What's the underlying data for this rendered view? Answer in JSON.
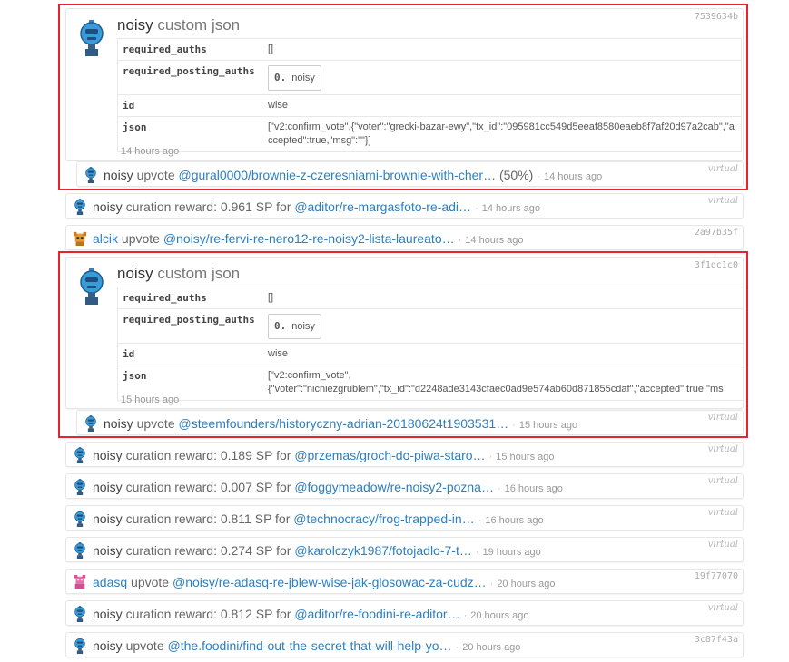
{
  "custom1": {
    "user": "noisy",
    "type": "custom json",
    "tag": "7539634b",
    "required_auths_label": "required_auths",
    "required_auths": "[]",
    "required_posting_auths_label": "required_posting_auths",
    "posting_index": "0.",
    "posting_name": "noisy",
    "id_label": "id",
    "id": "wise",
    "json_label": "json",
    "json": "[\"v2:confirm_vote\",{\"voter\":\"grecki-bazar-ewy\",\"tx_id\":\"095981cc549d5eeaf8580eaeb8f7af20d97a2cab\",\"accepted\":true,\"msg\":\"\"}]",
    "time": "14 hours ago"
  },
  "custom2": {
    "user": "noisy",
    "type": "custom json",
    "tag": "3f1dc1c0",
    "required_auths_label": "required_auths",
    "required_auths": "[]",
    "required_posting_auths_label": "required_posting_auths",
    "posting_index": "0.",
    "posting_name": "noisy",
    "id_label": "id",
    "id": "wise",
    "json_label": "json",
    "json": "[\"v2:confirm_vote\", {\"voter\":\"nicniezgrublem\",\"tx_id\":\"d2248ade3143cfaec0ad9e574ab60d871855cdaf\",\"accepted\":true,\"ms",
    "time": "15 hours ago"
  },
  "rows": [
    {
      "user": "noisy",
      "action": "upvote",
      "link": "@gural0000/brownie-z-czeresniami-brownie-with-cher…",
      "extra": " (50%)",
      "time": "14 hours ago",
      "tag": "virtual"
    },
    {
      "user": "noisy",
      "action": "curation reward: 0.961 SP for",
      "link": "@aditor/re-margasfoto-re-adi…",
      "extra": "",
      "time": "14 hours ago",
      "tag": "virtual"
    },
    {
      "user": "alcik",
      "action": "upvote",
      "link": "@noisy/re-fervi-re-nero12-re-noisy2-lista-laureato…",
      "extra": "",
      "time": "14 hours ago",
      "tag": "2a97b35f"
    },
    {
      "user": "noisy",
      "action": "upvote",
      "link": "@steemfounders/historyczny-adrian-20180624t1903531…",
      "extra": "",
      "time": "15 hours ago",
      "tag": "virtual"
    },
    {
      "user": "noisy",
      "action": "curation reward: 0.189 SP for",
      "link": "@przemas/groch-do-piwa-staro…",
      "extra": "",
      "time": "15 hours ago",
      "tag": "virtual"
    },
    {
      "user": "noisy",
      "action": "curation reward: 0.007 SP for",
      "link": "@foggymeadow/re-noisy2-pozna…",
      "extra": "",
      "time": "16 hours ago",
      "tag": "virtual"
    },
    {
      "user": "noisy",
      "action": "curation reward: 0.811 SP for",
      "link": "@technocracy/frog-trapped-in…",
      "extra": "",
      "time": "16 hours ago",
      "tag": "virtual"
    },
    {
      "user": "noisy",
      "action": "curation reward: 0.274 SP for",
      "link": "@karolczyk1987/fotojadlo-7-t…",
      "extra": "",
      "time": "19 hours ago",
      "tag": "virtual"
    },
    {
      "user": "adasq",
      "action": "upvote",
      "link": "@noisy/re-adasq-re-jblew-wise-jak-glosowac-za-cudz…",
      "extra": "",
      "time": "20 hours ago",
      "tag": "19f77070"
    },
    {
      "user": "noisy",
      "action": "curation reward: 0.812 SP for",
      "link": "@aditor/re-foodini-re-aditor…",
      "extra": "",
      "time": "20 hours ago",
      "tag": "virtual"
    },
    {
      "user": "noisy",
      "action": "upvote",
      "link": "@the.foodini/find-out-the-secret-that-will-help-yo…",
      "extra": "",
      "time": "20 hours ago",
      "tag": "3c87f43a"
    }
  ],
  "colors": {
    "highlight": "#e8232f",
    "link": "#2c7fc0"
  }
}
